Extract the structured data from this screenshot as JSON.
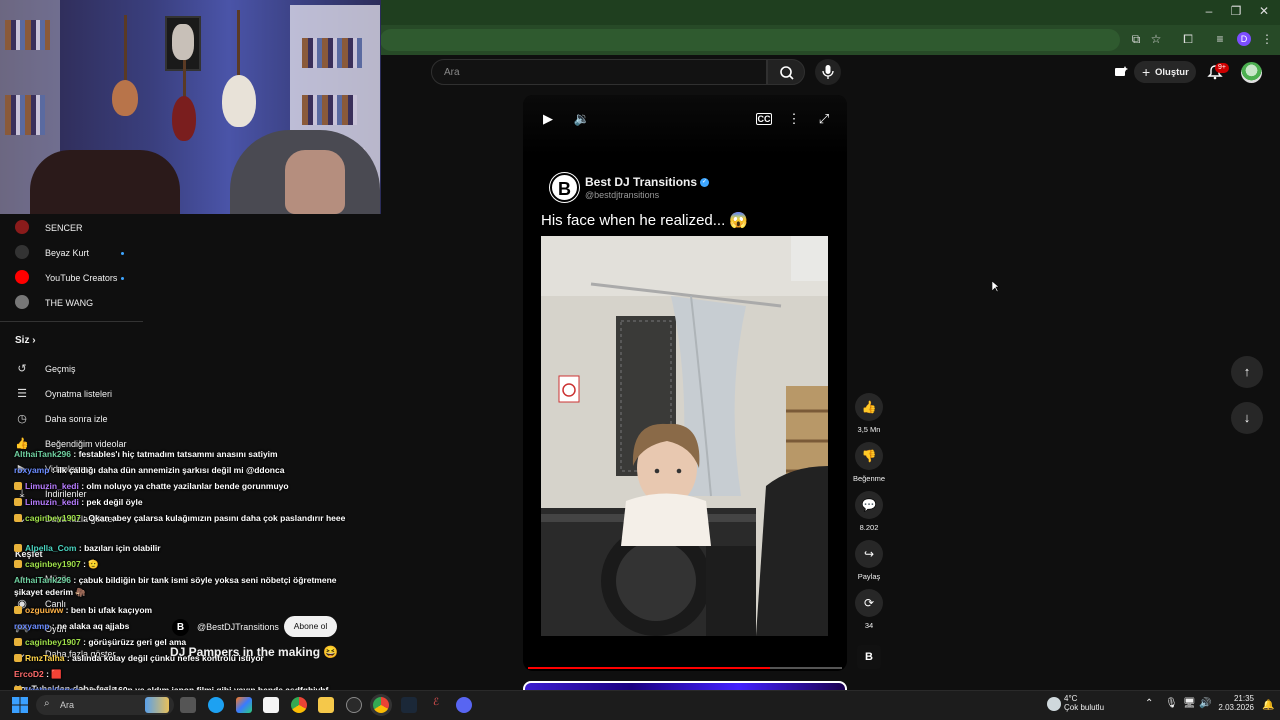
{
  "search": {
    "placeholder": "Ara"
  },
  "header": {
    "create_label": "Oluştur",
    "notification_count": "9+",
    "profile_initial": "D"
  },
  "sidebar": {
    "subscriptions": [
      {
        "label": "SENCER",
        "color": "#8a1b1b",
        "new": false
      },
      {
        "label": "Beyaz Kurt",
        "color": "#333333",
        "new": true
      },
      {
        "label": "YouTube Creators",
        "color": "#ff0000",
        "new": true
      },
      {
        "label": "THE WANG",
        "color": "#777777",
        "new": false
      }
    ],
    "you_section": {
      "title": "Siz",
      "items": [
        {
          "label": "Geçmiş",
          "icon": "history-icon"
        },
        {
          "label": "Oynatma listeleri",
          "icon": "playlist-icon"
        },
        {
          "label": "Daha sonra izle",
          "icon": "clock-icon"
        },
        {
          "label": "Beğendiğim videolar",
          "icon": "thumbs-up-icon"
        },
        {
          "label": "Videolarınız",
          "icon": "video-icon"
        },
        {
          "label": "İndirilenler",
          "icon": "download-icon"
        },
        {
          "label": "Daha fazla göster",
          "icon": "chevron-down-icon"
        }
      ]
    },
    "explore": {
      "title": "Keşfet",
      "items": [
        {
          "label": "Müzik",
          "icon": "music-icon"
        },
        {
          "label": "Canlı",
          "icon": "live-icon"
        },
        {
          "label": "Oyun",
          "icon": "game-icon"
        },
        {
          "label": "Daha fazla göster",
          "icon": "chevron-down-icon"
        }
      ]
    },
    "footer_title": "YouTube'dan daha fazla"
  },
  "chat": [
    {
      "user": "AlthaiTank296",
      "color": "#6fd0a0",
      "badge": false,
      "text": ": festables'ı hiç tatmadım tatsammı anasını satiyim"
    },
    {
      "user": "roxyamp",
      "color": "#6b8cff",
      "badge": false,
      "text": ": ilk çaldığı daha dün annemizin şarkısı değil mi @ddonca"
    },
    {
      "user": "Limuzin_kedi",
      "color": "#b77cff",
      "badge": true,
      "text": ": olm noluyo ya chatte yazilanlar bende gorunmuyo"
    },
    {
      "user": "Limuzin_kedi",
      "color": "#b77cff",
      "badge": true,
      "text": ": pek değil öyle"
    },
    {
      "user": "caginbey1907",
      "color": "#9fe04a",
      "badge": true,
      "text": ": Okan abey çalarsa kulağımızın pasını daha çok paslandırır heee"
    },
    {
      "user": "Alpella_Com",
      "color": "#4ad4c0",
      "badge": true,
      "text": ": bazıları için olabilir"
    },
    {
      "user": "caginbey1907",
      "color": "#9fe04a",
      "badge": true,
      "text": ": 🫡"
    },
    {
      "user": "AlthaiTank296",
      "color": "#6fd0a0",
      "badge": false,
      "text": ": çabuk bildiğin bir tank ismi söyle yoksa seni nöbetçi öğretmene şikayet ederim 🦣"
    },
    {
      "user": "ozguuww",
      "color": "#ffb347",
      "badge": true,
      "text": ": ben bi ufak kaçıyom"
    },
    {
      "user": "roxyamp",
      "color": "#6b8cff",
      "badge": false,
      "text": ": ne alaka aq ajjabs"
    },
    {
      "user": "caginbey1907",
      "color": "#9fe04a",
      "badge": true,
      "text": ": görüşürüzz geri gel ama"
    },
    {
      "user": "RmzTalha",
      "color": "#ffd54a",
      "badge": true,
      "text": ": aslında kolay değil çünkü nefes kontrolü istiyor"
    },
    {
      "user": "ErcoD2",
      "color": "#ff6b6b",
      "badge": false,
      "text": ": 🟥"
    },
    {
      "user": "Vastaskinpoe",
      "color": "#6b8cff",
      "badge": true,
      "text": ": yayını 160p ye aldım japon filmi gibi yayın bende asdfghjvhf"
    }
  ],
  "short": {
    "channel_name": "Best DJ Transitions",
    "channel_handle": "@bestdjtransitions",
    "channel_logo_letter": "B",
    "caption": "His face when he realized... 😱",
    "progress_percent": 77
  },
  "actions": {
    "like_count": "3,5 Mn",
    "dislike_label": "Beğenme",
    "comment_count": "8.202",
    "share_label": "Paylaş",
    "remix_count": "34"
  },
  "overlay": {
    "handle": "@BestDJTransitions",
    "subscribe_label": "Abone ol",
    "title": "DJ Pampers in the making 😆"
  },
  "taskbar": {
    "search_label": "Ara",
    "weather_temp": "4°C",
    "weather_desc": "Çok bulutlu",
    "time": "21:35",
    "date": "2.03.2026"
  }
}
